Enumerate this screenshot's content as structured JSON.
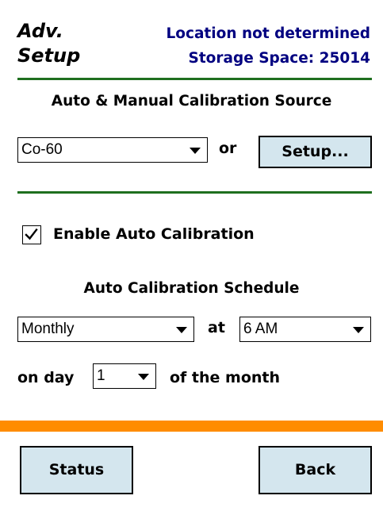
{
  "header": {
    "title_line1": "Adv.",
    "title_line2": "Setup",
    "location_status": "Location not determined",
    "storage_space": "Storage Space: 25014"
  },
  "calibration_source": {
    "heading": "Auto & Manual Calibration Source",
    "source_value": "Co-60",
    "or_label": "or",
    "setup_button": "Setup..."
  },
  "auto_calibration": {
    "enable_label": "Enable Auto Calibration",
    "enabled": true,
    "schedule_heading": "Auto Calibration Schedule",
    "frequency_value": "Monthly",
    "at_label": "at",
    "time_value": "6 AM",
    "on_day_label": "on day",
    "day_value": "1",
    "of_month_label": "of the month"
  },
  "footer": {
    "status_button": "Status",
    "back_button": "Back"
  },
  "colors": {
    "title_blue": "#000080",
    "rule_green": "#1f6f1f",
    "footer_orange": "#ff8c00",
    "button_fill": "#d4e6ee"
  },
  "icons": [
    "dropdown-arrow-icon",
    "checkmark-icon"
  ]
}
